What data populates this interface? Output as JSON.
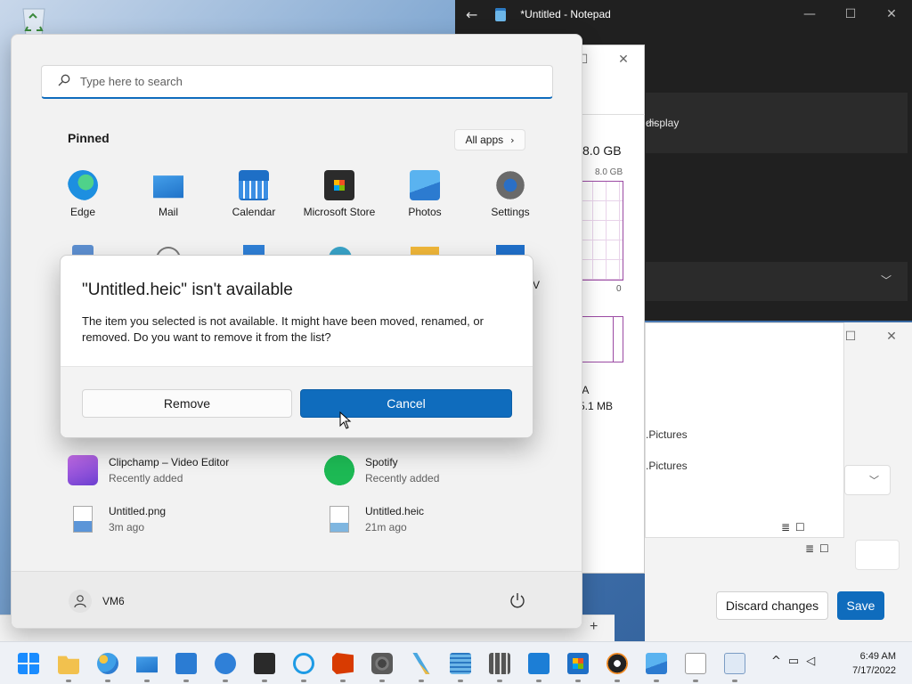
{
  "notepad": {
    "title": "*Untitled - Notepad",
    "panel_label": "display"
  },
  "taskmgr": {
    "mem_total": "8.0 GB",
    "mem_small": "8.0 GB",
    "zero": "0",
    "na": "/A",
    "mb": "5.1 MB"
  },
  "photos": {
    "path1": ".Pictures",
    "path2": ".Pictures",
    "discard_label": "Discard changes",
    "save_label": "Save"
  },
  "start": {
    "search_placeholder": "Type here to search",
    "pinned_label": "Pinned",
    "all_apps_label": "All apps",
    "pinned": [
      {
        "label": "Edge",
        "icon": "edge-icon"
      },
      {
        "label": "Mail",
        "icon": "mail-icon"
      },
      {
        "label": "Calendar",
        "icon": "calendar-icon"
      },
      {
        "label": "Microsoft Store",
        "icon": "store-icon"
      },
      {
        "label": "Photos",
        "icon": "photos-icon"
      },
      {
        "label": "Settings",
        "icon": "settings-icon"
      }
    ],
    "partial_row_label": "V",
    "recommended": [
      {
        "title": "Clipchamp – Video Editor",
        "sub": "Recently added",
        "icon": "clipchamp-icon"
      },
      {
        "title": "Spotify",
        "sub": "Recently added",
        "icon": "spotify-icon"
      },
      {
        "title": "Untitled.png",
        "sub": "3m ago",
        "icon": "image-file-icon"
      },
      {
        "title": "Untitled.heic",
        "sub": "21m ago",
        "icon": "heic-file-icon"
      }
    ],
    "user_name": "VM6"
  },
  "dialog": {
    "title": "\"Untitled.heic\" isn't available",
    "message": "The item you selected is not available. It might have been moved, renamed, or removed. Do you want to remove it from the list?",
    "remove_label": "Remove",
    "cancel_label": "Cancel"
  },
  "taskbar": {
    "time": "6:49 AM",
    "date": "7/17/2022",
    "apps": [
      "start",
      "file-explorer",
      "paint",
      "mail",
      "movies",
      "get-help",
      "terminal",
      "cortana",
      "office",
      "camera",
      "snipping-tool",
      "notepad",
      "calculator",
      "pc-connect",
      "store",
      "media-player",
      "photos",
      "solitaire",
      "task-manager"
    ]
  },
  "colors": {
    "accent": "#0f6cbd",
    "taskbar": "#eef1f6",
    "start_bg": "#f2f2f2"
  }
}
